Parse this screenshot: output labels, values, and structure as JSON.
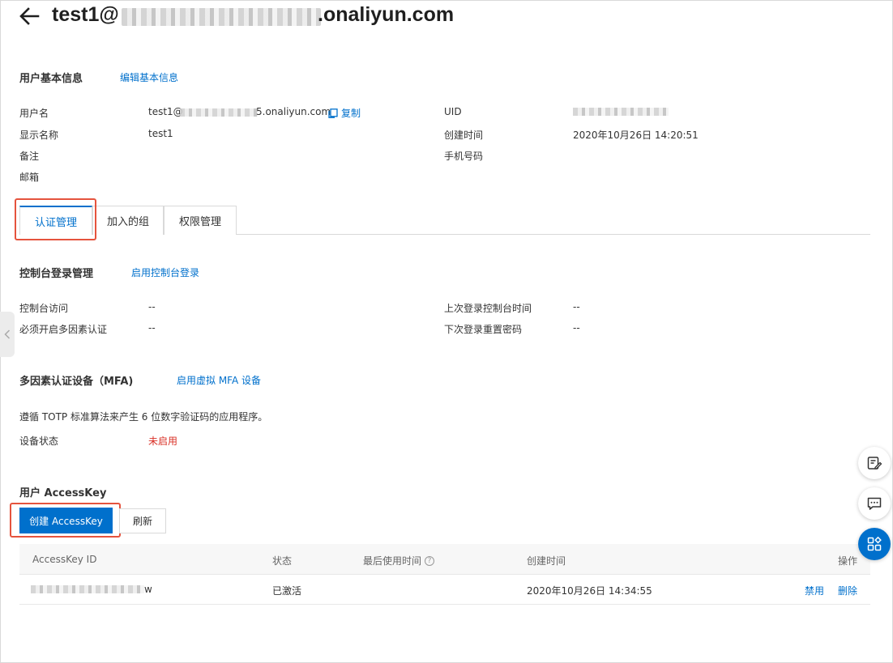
{
  "header": {
    "title_prefix": "test1@",
    "title_suffix": ".onaliyun.com"
  },
  "basic_info": {
    "title": "用户基本信息",
    "edit_link": "编辑基本信息",
    "username_label": "用户名",
    "username_prefix": "test1@",
    "username_suffix": "5.onaliyun.com",
    "copy_label": "复制",
    "display_name_label": "显示名称",
    "display_name_value": "test1",
    "remark_label": "备注",
    "email_label": "邮箱",
    "uid_label": "UID",
    "created_label": "创建时间",
    "created_value": "2020年10月26日 14:20:51",
    "phone_label": "手机号码"
  },
  "tabs": [
    {
      "label": "认证管理"
    },
    {
      "label": "加入的组"
    },
    {
      "label": "权限管理"
    }
  ],
  "console_login": {
    "title": "控制台登录管理",
    "enable_link": "启用控制台登录",
    "access_label": "控制台访问",
    "access_value": "--",
    "mfa_required_label": "必须开启多因素认证",
    "mfa_required_value": "--",
    "last_login_label": "上次登录控制台时间",
    "last_login_value": "--",
    "reset_pwd_label": "下次登录重置密码",
    "reset_pwd_value": "--"
  },
  "mfa": {
    "title": "多因素认证设备（MFA)",
    "enable_link": "启用虚拟 MFA 设备",
    "description": "遵循 TOTP 标准算法来产生 6 位数字验证码的应用程序。",
    "status_label": "设备状态",
    "status_value": "未启用"
  },
  "accesskey": {
    "title": "用户 AccessKey",
    "create_button": "创建 AccessKey",
    "refresh_button": "刷新",
    "columns": {
      "id": "AccessKey ID",
      "status": "状态",
      "last_used": "最后使用时间",
      "created": "创建时间",
      "actions": "操作"
    },
    "rows": [
      {
        "id_suffix": "w",
        "status": "已激活",
        "created": "2020年10月26日 14:34:55",
        "disable": "禁用",
        "delete": "删除"
      }
    ]
  },
  "colors": {
    "link": "#0070cc",
    "primary": "#0070cc",
    "highlight_box": "#e5533d",
    "status_disabled": "#d93026"
  },
  "icons": {
    "back": "arrow-left-icon",
    "copy": "copy-icon",
    "help": "question-circle-icon",
    "collapse": "chevron-left-icon",
    "feedback": "edit-document-icon",
    "chat": "chat-bubble-icon",
    "apps": "grid-apps-icon"
  }
}
